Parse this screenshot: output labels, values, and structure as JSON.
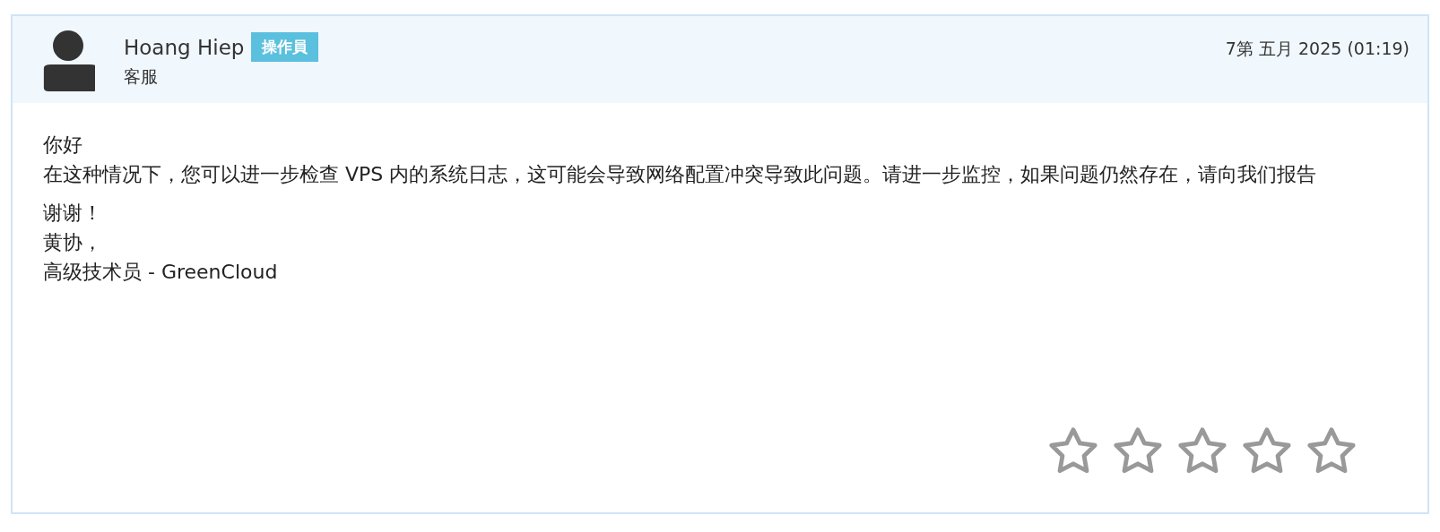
{
  "post": {
    "author": "Hoang Hiep",
    "badge": "操作員",
    "role": "客服",
    "date": "7第 五月 2025 (01:19)",
    "paragraphs": [
      [
        "你好",
        "在这种情况下，您可以进一步检查 VPS 内的系统日志，这可能会导致网络配置冲突导致此问题。请进一步监控，如果问题仍然存在，请向我们报告"
      ],
      [
        "谢谢！",
        "黄协，",
        "高级技术员 - GreenCloud"
      ]
    ],
    "rating": {
      "stars": 0
    }
  }
}
